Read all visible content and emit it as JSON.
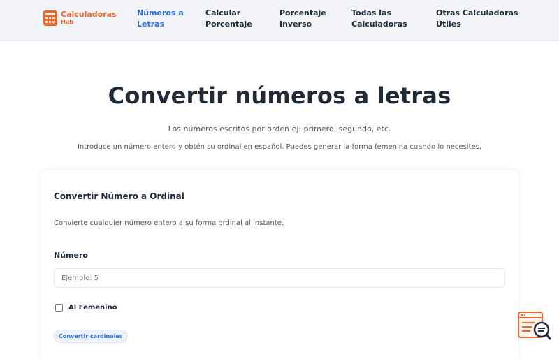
{
  "nav": {
    "brand_name": "Calculadoras",
    "brand_sub": "Hub",
    "brand_logo_icon": "calculator-icon",
    "links": [
      {
        "label": "Números a\nLetras",
        "active": true
      },
      {
        "label": "Calcular\nPorcentaje",
        "active": false
      },
      {
        "label": "Porcentaje\nInverso",
        "active": false
      },
      {
        "label": "Todas las\nCalculadoras",
        "active": false
      },
      {
        "label": "Otras Calculadoras\nÚtiles",
        "active": false
      }
    ]
  },
  "hero": {
    "title": "Convertir números a letras",
    "subtitle": "Los números escritos por orden ej: primero, segundo, etc.",
    "description": "Introduce un número entero y obtén su ordinal en español. Puedes generar la forma femenina cuando lo necesites."
  },
  "card": {
    "title": "Convertir Número a Ordinal",
    "description": "Convierte cualquier número entero a su forma ordinal al instante.",
    "number_label": "Número",
    "number_placeholder": "Ejemplo: 5",
    "number_value": "",
    "feminine_label": "Al Femenino",
    "feminine_checked": false,
    "cardinal_button": "Convertir cardinales"
  },
  "floating_widget_icon": "search-list-icon",
  "colors": {
    "brand_orange": "#e8692f",
    "link_active": "#2f6fd6",
    "nav_background": "#f1f3f7"
  }
}
